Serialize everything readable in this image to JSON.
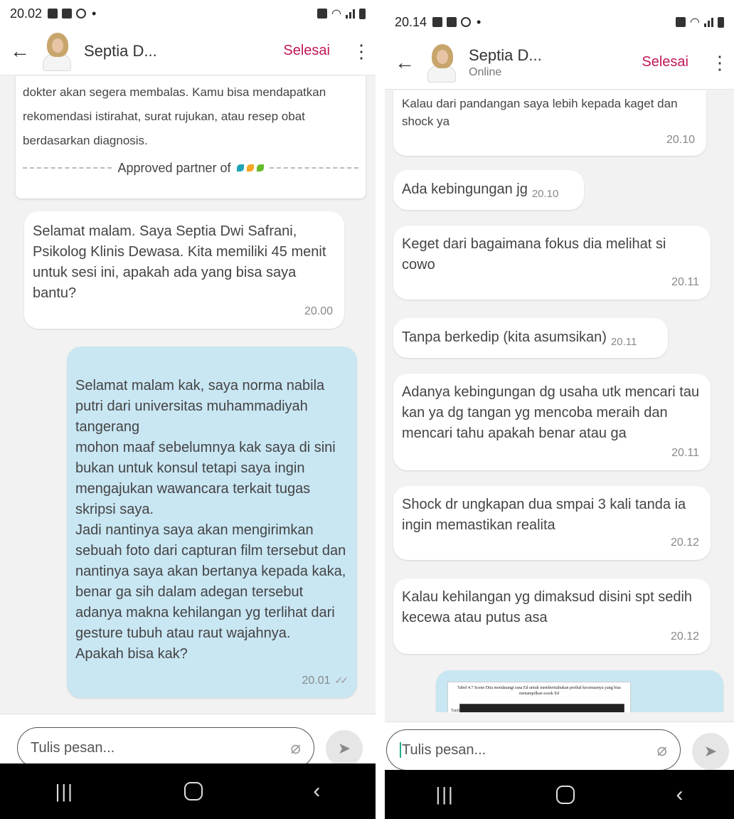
{
  "left": {
    "status": {
      "time": "20.02"
    },
    "header": {
      "name": "Septia D...",
      "status": "",
      "action": "Selesai"
    },
    "info": {
      "text": "dokter akan segera membalas. Kamu bisa mendapatkan rekomendasi istirahat, surat rujukan, atau resep obat berdasarkan diagnosis.",
      "approved": "Approved partner of"
    },
    "messages": [
      {
        "from": "doctor",
        "text": "Selamat malam. Saya Septia Dwi Safrani, Psikolog Klinis Dewasa. Kita memiliki 45 menit untuk sesi ini, apakah ada yang bisa saya bantu?",
        "time": "20.00"
      },
      {
        "from": "user",
        "text": "Selamat malam kak, saya norma nabila putri dari universitas muhammadiyah tangerang\nmohon maaf sebelumnya kak saya di sini bukan untuk konsul tetapi saya ingin mengajukan  wawancara  terkait tugas skripsi saya.\nJadi nantinya saya akan mengirimkan sebuah foto dari capturan film tersebut dan nantinya saya akan bertanya kepada kaka, benar ga sih dalam adegan tersebut adanya makna kehilangan yg terlihat dari gesture tubuh atau raut wajahnya.\nApakah bisa kak?",
        "time": "20.01"
      }
    ],
    "composer": {
      "placeholder": "Tulis pesan..."
    }
  },
  "right": {
    "status": {
      "time": "20.14"
    },
    "header": {
      "name": "Septia D...",
      "status": "Online",
      "action": "Selesai"
    },
    "messages": [
      {
        "text": "Kalau dari pandangan saya lebih kepada kaget dan shock ya",
        "time": "20.10"
      },
      {
        "text": "Ada kebingungan jg",
        "time": "20.10"
      },
      {
        "text": "Keget dari bagaimana fokus dia melihat si cowo",
        "time": "20.11"
      },
      {
        "text": "Tanpa berkedip (kita asumsikan)",
        "time": "20.11"
      },
      {
        "text": "Adanya kebingungan dg usaha utk mencari tau kan ya dg tangan yg mencoba meraih dan mencari tahu apakah benar atau ga",
        "time": "20.11"
      },
      {
        "text": "Shock dr ungkapan dua smpai 3 kali tanda ia ingin memastikan realita",
        "time": "20.12"
      },
      {
        "text": "Kalau kehilangan yg dimaksud disini spt sedih kecewa atau putus asa",
        "time": "20.12"
      }
    ],
    "attachment": {
      "caption": "Tabel 4.7 Scene Dita mendatangi rana Ed untuk memberitahukan perihal kecemasnya yang bisa menampilkan sosok Ed",
      "column": "Tanda"
    },
    "composer": {
      "placeholder": "Tulis pesan..."
    }
  },
  "colors": {
    "accent": "#c2185b",
    "sent_bubble": "#c9e6f3",
    "background": "#f2f2f2"
  },
  "icons": [
    "back-arrow-icon",
    "kebab-menu-icon",
    "paperclip-icon",
    "send-icon",
    "nav-recents-icon",
    "nav-home-icon",
    "nav-back-icon"
  ]
}
